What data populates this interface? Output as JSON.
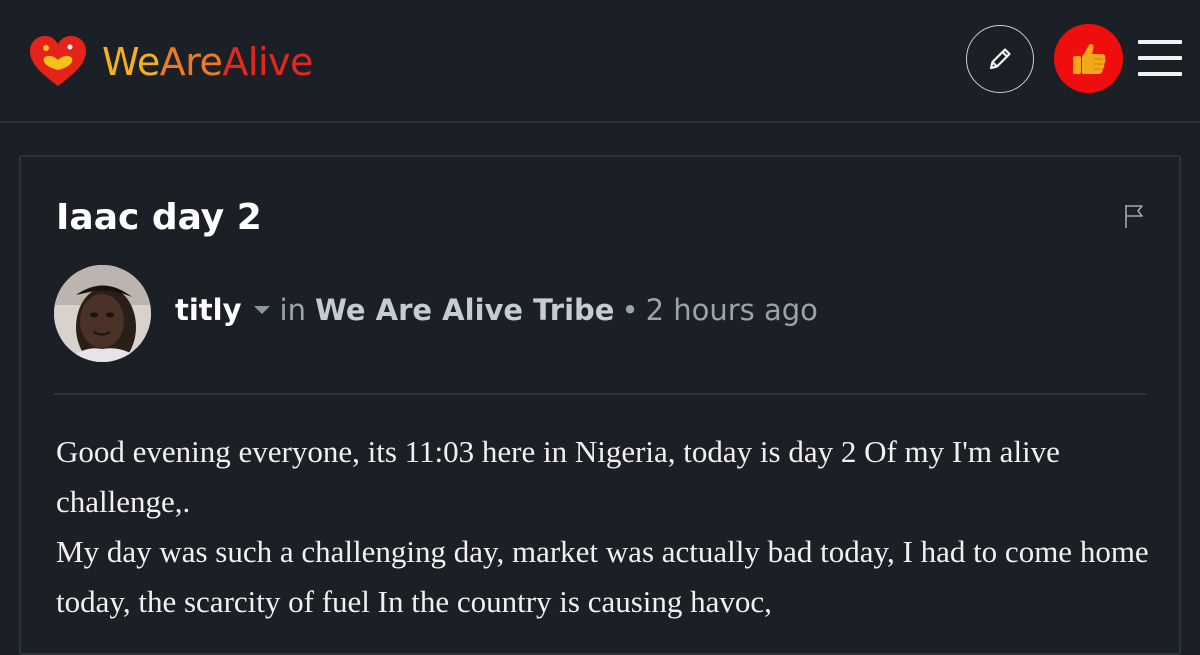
{
  "brand": {
    "name_part1": "We",
    "name_part2": "Are",
    "name_part3": "Alive",
    "colors": {
      "we": "#f3b11d",
      "are": "#f07b1e",
      "alive": "#e5281f"
    }
  },
  "header": {
    "edit_icon": "pencil-icon",
    "like_icon": "thumbs-up-icon",
    "menu_icon": "hamburger-menu-icon"
  },
  "post": {
    "title": "Iaac day 2",
    "author": "titly",
    "in_label": "in",
    "community": "We Are Alive Tribe",
    "separator": "•",
    "time_ago": "2 hours ago",
    "paragraphs": [
      "Good evening everyone, its 11:03 here in Nigeria, today is day 2 Of my I'm alive challenge,.",
      "My day was such a challenging day, market was actually bad today, I had to come home today, the scarcity of fuel In the country is causing havoc,"
    ]
  }
}
